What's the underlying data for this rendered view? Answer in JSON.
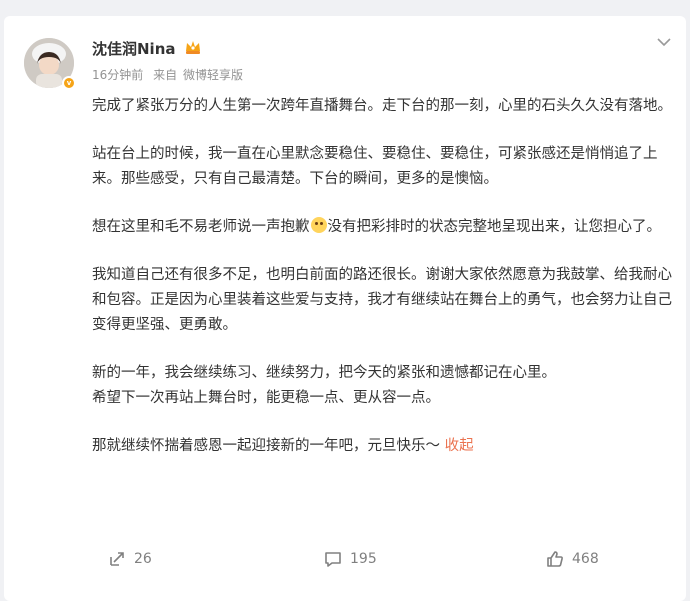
{
  "post": {
    "author": "沈佳润Nina",
    "time": "16分钟前",
    "source_prefix": "来自",
    "source": "微博轻享版",
    "paragraphs": [
      "完成了紧张万分的人生第一次跨年直播舞台。走下台的那一刻，心里的石头久久没有落地。",
      "站在台上的时候，我一直在心里默念要稳住、要稳住、要稳住，可紧张感还是悄悄追了上来。那些感受，只有自己最清楚。下台的瞬间，更多的是懊恼。",
      "想在这里和毛不易老师说一声抱歉",
      "没有把彩排时的状态完整地呈现出来，让您担心了。",
      "我知道自己还有很多不足，也明白前面的路还很长。谢谢大家依然愿意为我鼓掌、给我耐心和包容。正是因为心里装着这些爱与支持，我才有继续站在舞台上的勇气，也会努力让自己变得更坚强、更勇敢。",
      "新的一年，我会继续练习、继续努力，把今天的紧张和遗憾都记在心里。",
      "希望下一次再站上舞台时，能更稳一点、更从容一点。",
      "那就继续怀揣着感恩一起迎接新的一年吧，元旦快乐～"
    ],
    "collapse_label": "收起",
    "emoji": "sad-face-emoji"
  },
  "actions": {
    "repost": "26",
    "comment": "195",
    "like": "468"
  },
  "colors": {
    "link": "#eb7350",
    "text": "#333333",
    "meta": "#939393",
    "icon": "#808080"
  }
}
